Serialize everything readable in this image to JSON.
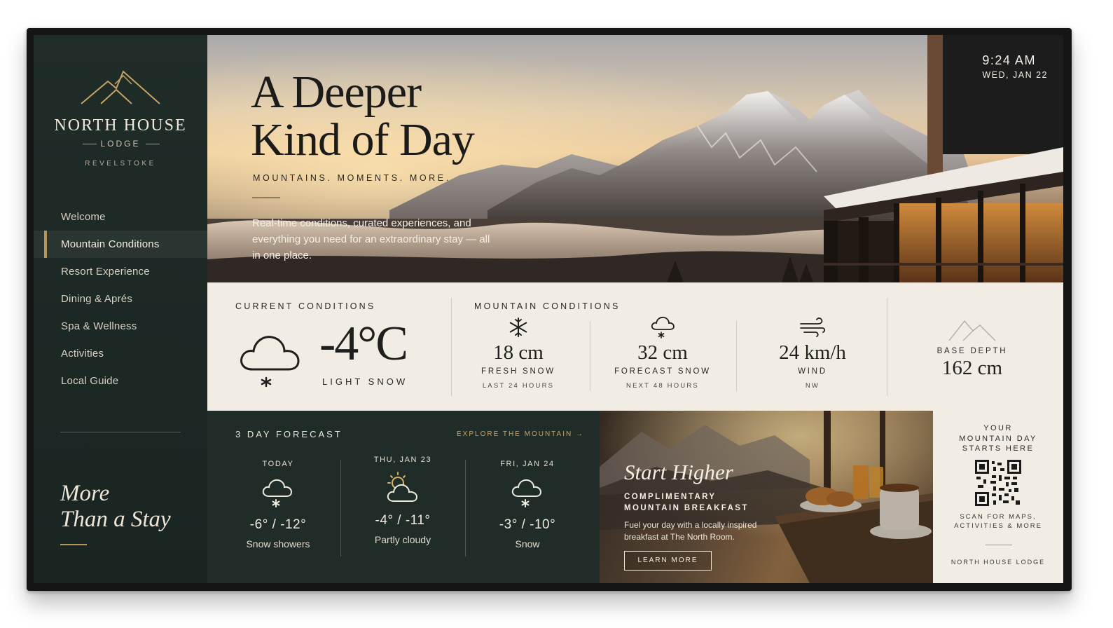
{
  "sidebar": {
    "brand_name": "NORTH HOUSE",
    "brand_sub": "LODGE",
    "location": "REVELSTOKE",
    "logo_icon": "mountain-logo-icon",
    "nav": [
      {
        "label": "Welcome",
        "active": false
      },
      {
        "label": "Mountain Conditions",
        "active": true
      },
      {
        "label": "Resort Experience",
        "active": false
      },
      {
        "label": "Dining & Aprés",
        "active": false
      },
      {
        "label": "Spa & Wellness",
        "active": false
      },
      {
        "label": "Activities",
        "active": false
      },
      {
        "label": "Local Guide",
        "active": false
      }
    ],
    "tagline_line1": "More",
    "tagline_line2": "Than a Stay"
  },
  "hero": {
    "title_line1": "A Deeper",
    "title_line2": "Kind of Day",
    "subtitle": "MOUNTAINS. MOMENTS. MORE.",
    "description": "Real-time conditions, curated experiences, and everything you need for an extraordinary stay — all in one place.",
    "time": "9:24 AM",
    "date": "WED, JAN 22"
  },
  "current": {
    "label": "CURRENT CONDITIONS",
    "icon": "snow-cloud-icon",
    "temperature": "-4°C",
    "description": "LIGHT SNOW"
  },
  "mountain": {
    "label": "MOUNTAIN CONDITIONS",
    "stats": [
      {
        "icon": "snowflake-icon",
        "value": "18 cm",
        "label": "FRESH SNOW",
        "sub": "LAST 24 HOURS"
      },
      {
        "icon": "snow-cloud-icon",
        "value": "32 cm",
        "label": "FORECAST SNOW",
        "sub": "NEXT 48 HOURS"
      },
      {
        "icon": "wind-icon",
        "value": "24 km/h",
        "label": "WIND",
        "sub": "NW"
      }
    ],
    "base": {
      "icon": "mountain-outline-icon",
      "label": "BASE DEPTH",
      "value": "162 cm"
    }
  },
  "forecast": {
    "label": "3 DAY FORECAST",
    "link": "EXPLORE THE MOUNTAIN →",
    "days": [
      {
        "name": "TODAY",
        "icon": "snow-cloud-icon",
        "temps": "-6° / -12°",
        "condition": "Snow showers"
      },
      {
        "name": "THU, JAN 23",
        "icon": "partly-cloudy-icon",
        "temps": "-4° / -11°",
        "condition": "Partly cloudy"
      },
      {
        "name": "FRI, JAN 24",
        "icon": "snow-cloud-icon",
        "temps": "-3° / -10°",
        "condition": "Snow"
      }
    ]
  },
  "promo": {
    "title": "Start Higher",
    "eyebrow_line1": "COMPLIMENTARY",
    "eyebrow_line2": "MOUNTAIN BREAKFAST",
    "description": "Fuel your day with a locally inspired breakfast at The North Room.",
    "button": "LEARN MORE"
  },
  "qr": {
    "head_line1": "YOUR",
    "head_line2": "MOUNTAIN DAY",
    "head_line3": "STARTS HERE",
    "sub_line1": "SCAN FOR MAPS,",
    "sub_line2": "ACTIVITIES & MORE",
    "footer": "NORTH HOUSE LODGE"
  },
  "colors": {
    "sidebar_bg": "#1f2c28",
    "accent_gold": "#b89558",
    "panel_cream": "#f2ede4",
    "text_dark": "#1f1f1e"
  }
}
